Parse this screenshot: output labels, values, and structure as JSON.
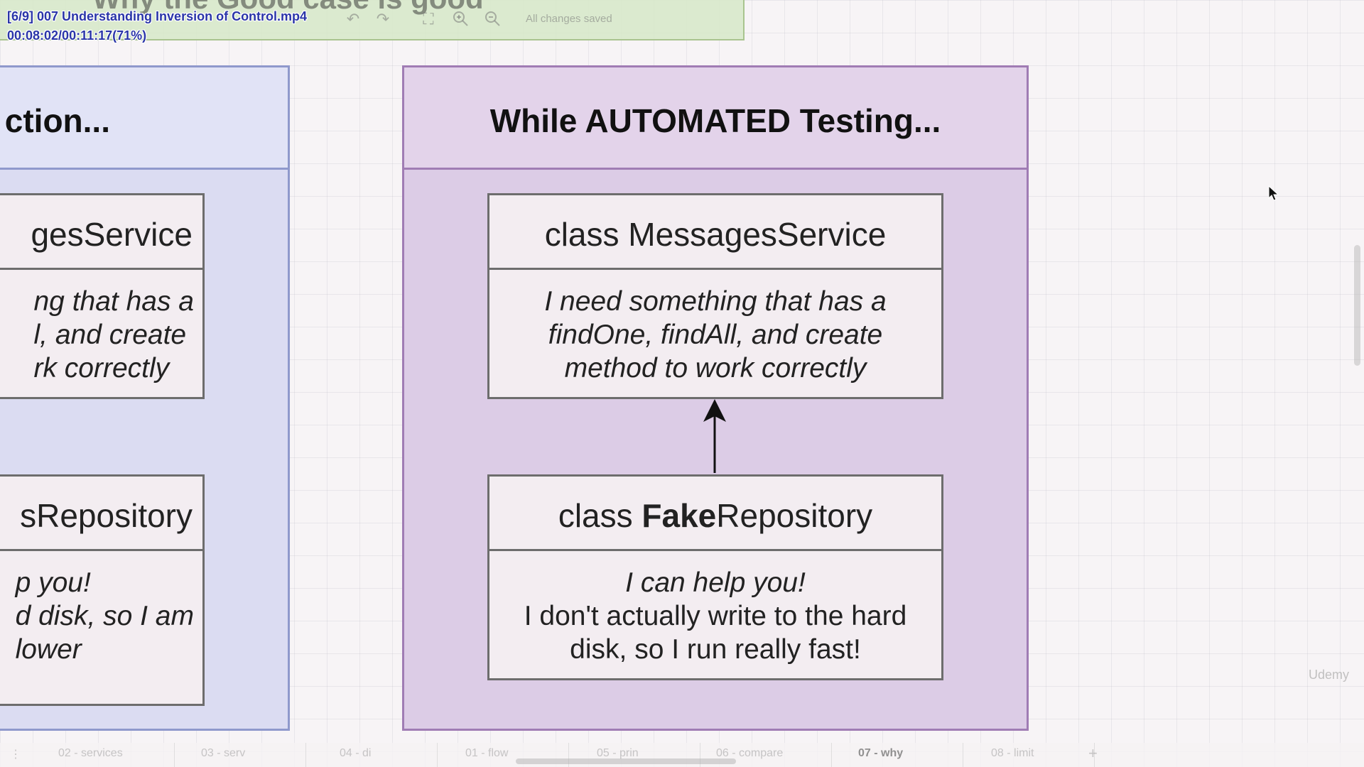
{
  "video": {
    "title": "[6/9] 007 Understanding Inversion of Control.mp4",
    "time": "00:08:02/00:11:17(71%)"
  },
  "page_heading": "Why the Good case is good",
  "toolbar": {
    "status": "All changes saved",
    "icons": [
      "undo-icon",
      "redo-icon",
      "fullscreen-icon",
      "zoom-in-icon",
      "zoom-out-icon"
    ]
  },
  "left_panel": {
    "title": "ction...",
    "box1": {
      "name": "gesService",
      "lines": [
        "ng that has a",
        "l, and create",
        "rk correctly"
      ]
    },
    "box2": {
      "name": "sRepository",
      "lines": [
        "p you!",
        "d disk, so I am",
        "lower"
      ]
    }
  },
  "right_panel": {
    "title": "While AUTOMATED Testing...",
    "box1": {
      "name": "class MessagesService",
      "lines": [
        "I need something that has a",
        "findOne, findAll, and create",
        "method to work correctly"
      ]
    },
    "box2": {
      "name_prefix": "class ",
      "name_bold": "Fake",
      "name_suffix": "Repository",
      "line1": "I can help you!",
      "line2": "I don't actually write to the hard",
      "line3": "disk, so I run really fast!"
    }
  },
  "tabs": [
    "02 - services",
    "03 - serv",
    "04 - di",
    "01 - flow",
    "05 - prin",
    "06 - compare",
    "07 - why",
    "08 - limit"
  ],
  "active_tab": "07 - why",
  "watermark": "Udemy",
  "colors": {
    "left_panel": "#dbdcf2",
    "right_panel": "#dccce6",
    "file_title": "#2a35a8"
  }
}
